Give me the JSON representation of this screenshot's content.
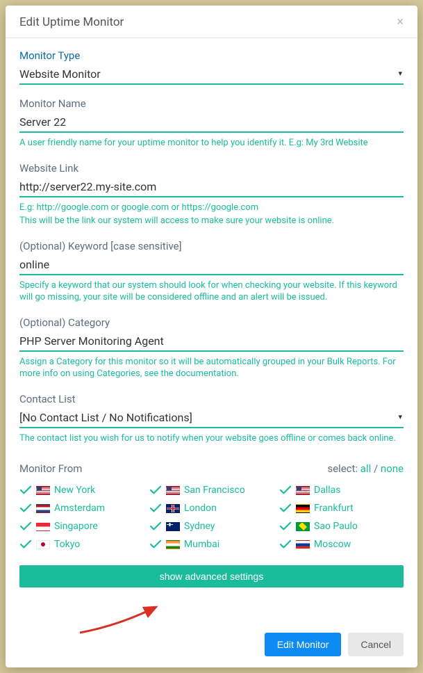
{
  "modal": {
    "title": "Edit Uptime Monitor"
  },
  "monitorType": {
    "label": "Monitor Type",
    "value": "Website Monitor"
  },
  "monitorName": {
    "label": "Monitor Name",
    "value": "Server 22",
    "help": "A user friendly name for your uptime monitor to help you identify it. E.g: My 3rd Website"
  },
  "websiteLink": {
    "label": "Website Link",
    "value": "http://server22.my-site.com",
    "help1": "E.g: http://google.com or google.com or https://google.com",
    "help2": "This will be the link our system will access to make sure your website is online."
  },
  "keyword": {
    "label": "(Optional) Keyword [case sensitive]",
    "value": "online",
    "help": "Specify a keyword that our system should look for when checking your website. If this keyword will go missing, your site will be considered offline and an alert will be issued."
  },
  "category": {
    "label": "(Optional) Category",
    "value": "PHP Server Monitoring Agent",
    "help": "Assign a Category for this monitor so it will be automatically grouped in your Bulk Reports. For more info on using Categories, see the documentation."
  },
  "contactList": {
    "label": "Contact List",
    "value": "[No Contact List / No Notifications]",
    "help": "The contact list you wish for us to notify when your website goes offline or comes back online."
  },
  "monitorFrom": {
    "label": "Monitor From",
    "selectLabel": "select:",
    "allLabel": "all",
    "noneLabel": "none",
    "locations": [
      {
        "name": "New York",
        "flag": "us"
      },
      {
        "name": "San Francisco",
        "flag": "us"
      },
      {
        "name": "Dallas",
        "flag": "us"
      },
      {
        "name": "Amsterdam",
        "flag": "nl"
      },
      {
        "name": "London",
        "flag": "gb"
      },
      {
        "name": "Frankfurt",
        "flag": "de"
      },
      {
        "name": "Singapore",
        "flag": "sg"
      },
      {
        "name": "Sydney",
        "flag": "au"
      },
      {
        "name": "Sao Paulo",
        "flag": "br"
      },
      {
        "name": "Tokyo",
        "flag": "jp"
      },
      {
        "name": "Mumbai",
        "flag": "in"
      },
      {
        "name": "Moscow",
        "flag": "ru"
      }
    ]
  },
  "buttons": {
    "advanced": "show advanced settings",
    "submit": "Edit Monitor",
    "cancel": "Cancel"
  }
}
